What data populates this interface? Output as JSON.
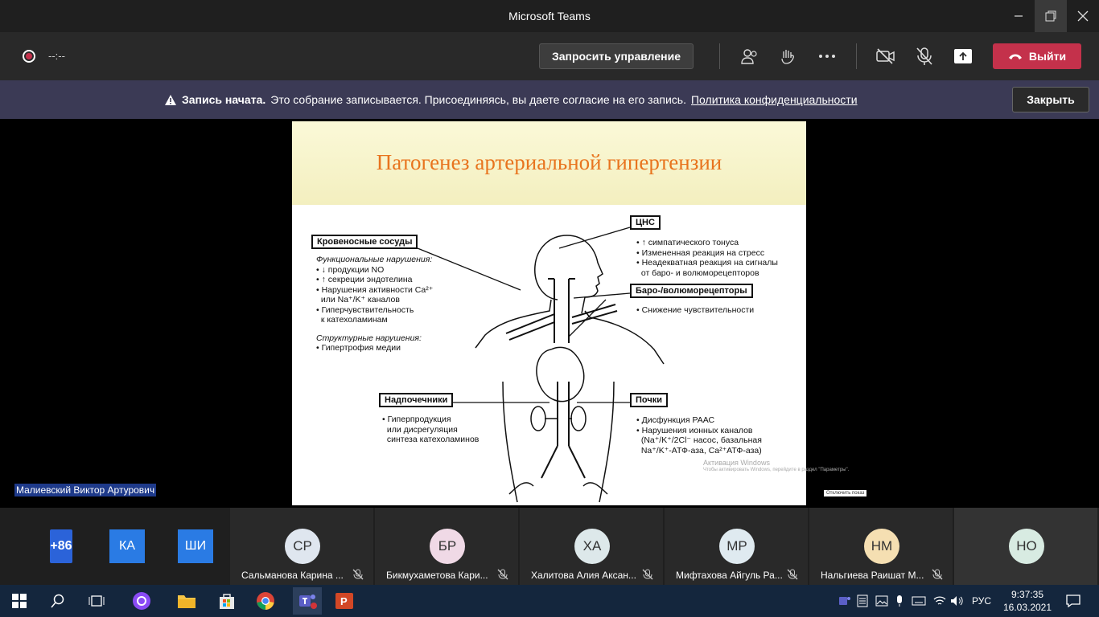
{
  "window": {
    "title": "Microsoft Teams"
  },
  "toolbar": {
    "timer": "--:--",
    "request_control": "Запросить управление",
    "leave": "Выйти"
  },
  "banner": {
    "bold": "Запись начата.",
    "text": "Это собрание записывается. Присоединяясь, вы даете согласие на его запись.",
    "link": "Политика конфиденциальности",
    "close": "Закрыть"
  },
  "slide": {
    "title": "Патогенез артериальной гипертензии",
    "vessels": {
      "header": "Кровеносные сосуды",
      "functional": "Функциональные нарушения:",
      "f1": "• ↓ продукции NO",
      "f2": "• ↑ секреции эндотелина",
      "f3": "• Нарушения активности Ca²⁺",
      "f4": "  или Na⁺/K⁺ каналов",
      "f5": "• Гиперчувствительность",
      "f6": "  к катехоламинам",
      "structural": "Структурные нарушения:",
      "s1": "• Гипертрофия медии"
    },
    "cns": {
      "header": "ЦНС",
      "l1": "• ↑ симпатического тонуса",
      "l2": "• Измененная реакция на стресс",
      "l3": "• Неадекватная реакция на сигналы",
      "l4": "  от баро- и волюморецепторов"
    },
    "baro": {
      "header": "Баро-/волюморецепторы",
      "l1": "• Снижение чувствительности"
    },
    "adrenal": {
      "header": "Надпочечники",
      "l1": "• Гиперпродукция",
      "l2": "  или дисрегуляция",
      "l3": "  синтеза катехоламинов"
    },
    "kidney": {
      "header": "Почки",
      "l1": "• Дисфункция РААС",
      "l2": "• Нарушения ионных каналов",
      "l3": "  (Na⁺/K⁺/2Cl⁻ насос, базальная",
      "l4": "  Na⁺/K⁺-АТФ-аза, Ca²⁺АТФ-аза)"
    }
  },
  "watermark": {
    "activate": "Активация Windows",
    "hint": "Чтобы активировать Windows, перейдите в раздел \"Параметры\".",
    "stop": "Отключить показ"
  },
  "speaker": "Малиевский Виктор Артурович",
  "overflow": [
    {
      "initials": "+86",
      "color": "#2b63d9"
    },
    {
      "initials": "КА",
      "color": "#2a7be4"
    },
    {
      "initials": "ШИ",
      "color": "#2a7be4"
    }
  ],
  "participants": [
    {
      "initials": "СР",
      "name": "Сальманова Карина ...",
      "color": "#dfe6ef"
    },
    {
      "initials": "БР",
      "name": "Бикмухаметова Кари...",
      "color": "#f0d9e6"
    },
    {
      "initials": "ХА",
      "name": "Халитова Алия Аксан...",
      "color": "#dde8ea"
    },
    {
      "initials": "МР",
      "name": "Мифтахова Айгуль Ра...",
      "color": "#dfeaf0"
    },
    {
      "initials": "НМ",
      "name": "Нальгиева Раишат М...",
      "color": "#f5dfb2"
    },
    {
      "initials": "НО",
      "name": "",
      "color": "#d8ebe2"
    }
  ],
  "taskbar": {
    "lang": "РУС",
    "time": "9:37:35",
    "date": "16.03.2021"
  },
  "colors": {
    "accent_leave": "#c4314b",
    "banner_bg": "#3b3a55",
    "slide_title": "#e8741e",
    "taskbar": "#14263d"
  }
}
